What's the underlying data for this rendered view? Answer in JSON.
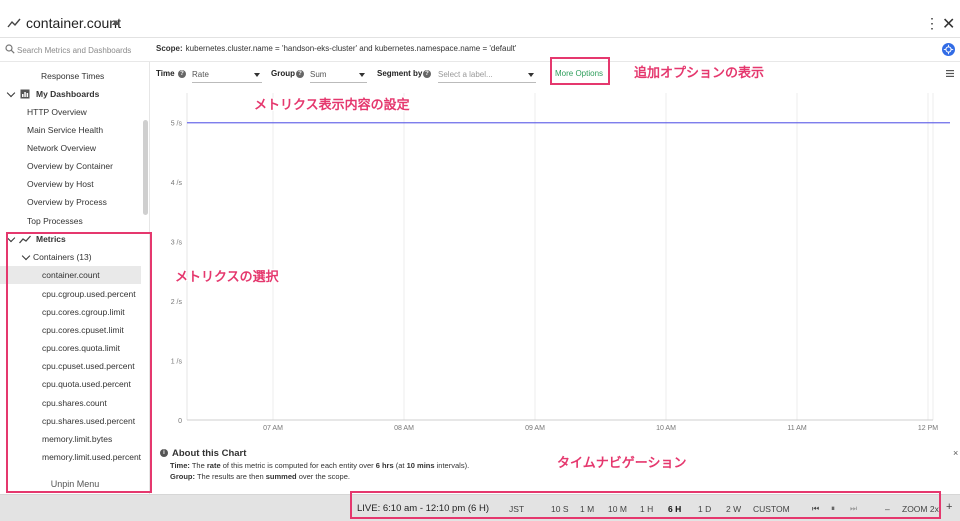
{
  "header": {
    "title": "container.count",
    "menu_icon": "kebab-icon",
    "close_glyph": "✕",
    "kebab_glyph": "⋮"
  },
  "scopebar": {
    "search_placeholder": "Search Metrics and Dashboards",
    "scope_label": "Scope:",
    "scope_value": "kubernetes.cluster.name = 'handson-eks-cluster' and kubernetes.namespace.name = 'default'"
  },
  "sidebar": {
    "items": [
      {
        "label": "Response Times"
      },
      {
        "label": "My Dashboards"
      },
      {
        "label": "HTTP Overview"
      },
      {
        "label": "Main Service Health"
      },
      {
        "label": "Network Overview"
      },
      {
        "label": "Overview by Container"
      },
      {
        "label": "Overview by Host"
      },
      {
        "label": "Overview by Process"
      },
      {
        "label": "Top Processes"
      },
      {
        "label": "Metrics"
      },
      {
        "label": "Containers (13)"
      },
      {
        "label": "container.count"
      },
      {
        "label": "cpu.cgroup.used.percent"
      },
      {
        "label": "cpu.cores.cgroup.limit"
      },
      {
        "label": "cpu.cores.cpuset.limit"
      },
      {
        "label": "cpu.cores.quota.limit"
      },
      {
        "label": "cpu.cpuset.used.percent"
      },
      {
        "label": "cpu.quota.used.percent"
      },
      {
        "label": "cpu.shares.count"
      },
      {
        "label": "cpu.shares.used.percent"
      },
      {
        "label": "memory.limit.bytes"
      },
      {
        "label": "memory.limit.used.percent"
      }
    ],
    "unpin_label": "Unpin Menu"
  },
  "controls": {
    "time_label": "Time",
    "time_value": "Rate",
    "group_label": "Group",
    "group_value": "Sum",
    "segment_label": "Segment by",
    "segment_placeholder": "Select a label...",
    "more_options": "More Options",
    "help_glyph": "?"
  },
  "chart_data": {
    "type": "line",
    "title": "",
    "xlabel": "",
    "ylabel": "",
    "x": [
      "07 AM",
      "08 AM",
      "09 AM",
      "10 AM",
      "11 AM",
      "12 PM"
    ],
    "yticks": [
      "0",
      "1 /s",
      "2 /s",
      "3 /s",
      "4 /s",
      "5 /s"
    ],
    "ylim": [
      0,
      5.5
    ],
    "series": [
      {
        "values": [
          5,
          5,
          5,
          5,
          5,
          5
        ],
        "color": "#6b6bea"
      }
    ],
    "grid": true
  },
  "about": {
    "info_glyph": "i",
    "heading": "About this Chart",
    "line1_label": "Time:",
    "line1_a": "The",
    "line1_b": "rate",
    "line1_c": "of this metric is computed for each entity over",
    "line1_d": "6 hrs",
    "line1_e": "(at",
    "line1_f": "10 mins",
    "line1_g": "intervals).",
    "line2_label": "Group:",
    "line2_a": "The results are then",
    "line2_b": "summed",
    "line2_c": "over the scope.",
    "close_glyph": "×"
  },
  "timebar": {
    "live": "LIVE: 6:10 am - 12:10 pm (6 H)",
    "timezone": "JST",
    "ranges": [
      "10 S",
      "1 M",
      "10 M",
      "1 H",
      "6 H",
      "1 D",
      "2 W",
      "CUSTOM"
    ],
    "active_range": "6 H",
    "prev_glyph": "⏮",
    "pause_glyph": "⏸",
    "next_glyph": "⏭",
    "zoom_minus": "–",
    "zoom_label": "ZOOM 2x",
    "zoom_plus": "+"
  },
  "annotations": {
    "more_options_note": "追加オプションの表示",
    "settings_note": "メトリクス表示内容の設定",
    "metrics_note": "メトリクスの選択",
    "timenav_note": "タイムナビゲーション",
    "color": "#e5386e"
  }
}
